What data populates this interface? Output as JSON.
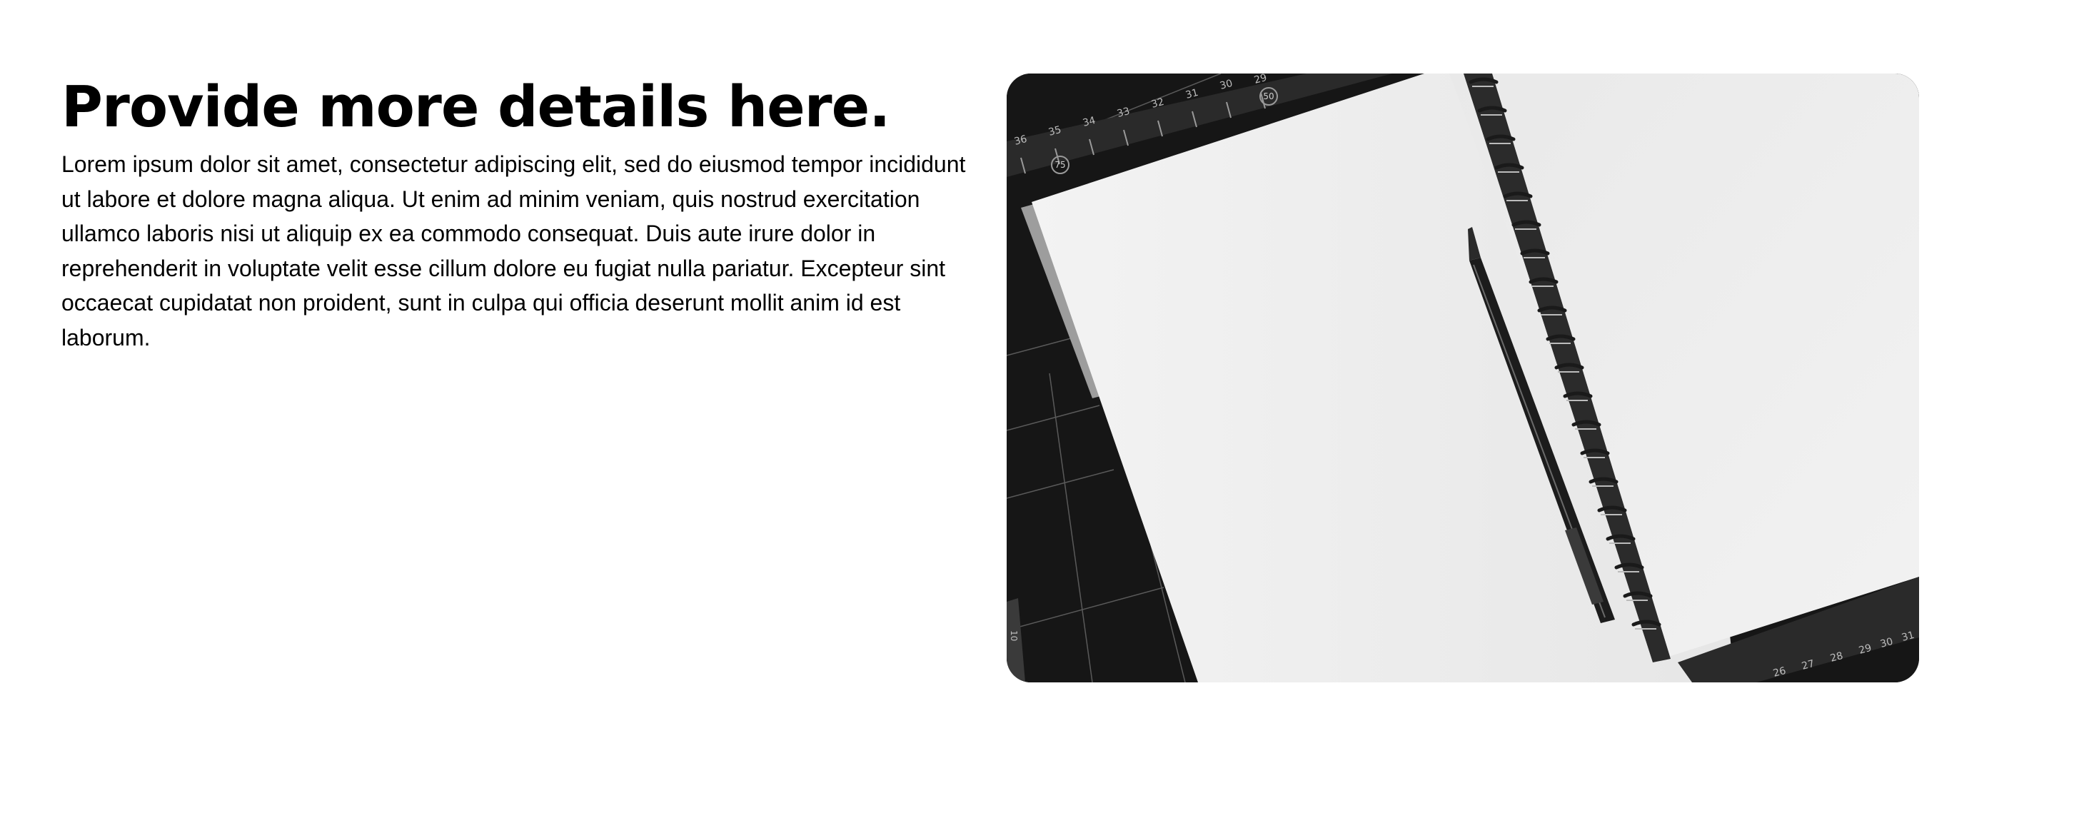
{
  "section": {
    "title": "Provide more details here.",
    "body": "Lorem ipsum dolor sit amet, consectetur adipiscing elit, sed do eiusmod tempor incididunt ut labore et dolore magna aliqua. Ut enim ad minim veniam, quis nostrud exercitation ullamco laboris nisi ut aliquip ex ea commodo consequat. Duis aute irure dolor in reprehenderit in voluptate velit esse cillum dolore eu fugiat nulla pariatur. Excepteur sint occaecat cupidatat non proident, sunt in culpa qui officia deserunt mollit anim id est laborum."
  },
  "image": {
    "subject": "notebook-photo",
    "ruler_top_labels": [
      "36",
      "35",
      "34",
      "33",
      "32",
      "31",
      "30",
      "29"
    ],
    "ruler_bottom_labels": [
      "26",
      "27",
      "28",
      "29",
      "30",
      "31"
    ],
    "mat_labels": [
      "75",
      "50"
    ],
    "side_label": "10"
  },
  "colors": {
    "text": "#000000",
    "background": "#ffffff",
    "mat": "#161616",
    "paper": "#ededed"
  }
}
